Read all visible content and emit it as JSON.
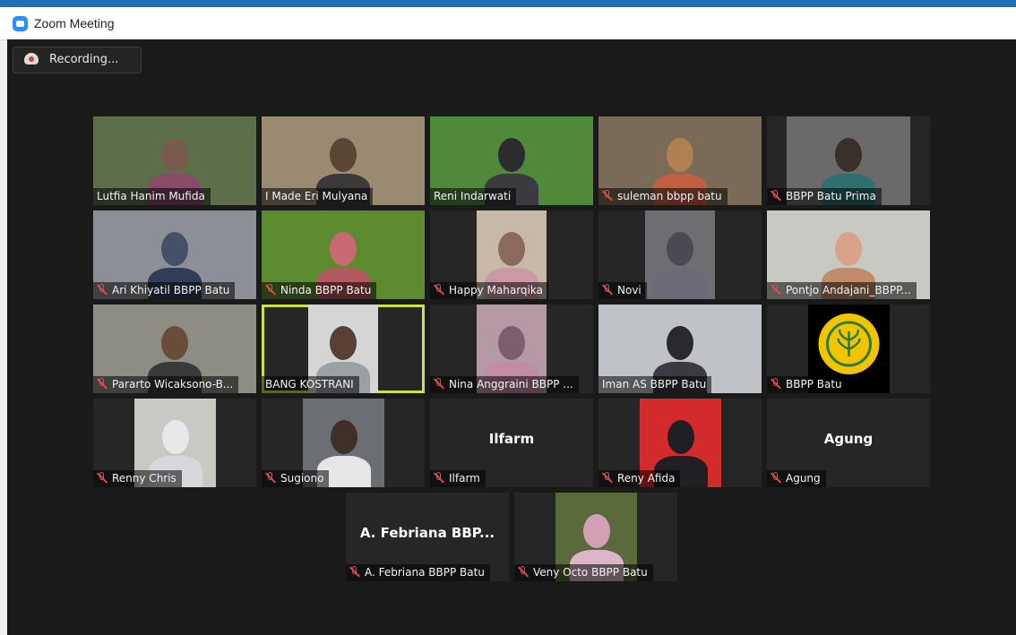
{
  "window": {
    "title": "Zoom Meeting"
  },
  "recording": {
    "label": "Recording...",
    "icon": "cloud-record-icon"
  },
  "rows": [
    [
      {
        "name": "Lutfia Hanim Mufida",
        "muted": false,
        "bg": "#5c6e4a",
        "fill": 1.0,
        "head": "#7b5a4e",
        "body": "#8a4a6a"
      },
      {
        "name": "I Made Eri Mulyana",
        "muted": false,
        "bg": "#9a8a72",
        "fill": 1.0,
        "head": "#5b4636",
        "body": "#3a3a3a"
      },
      {
        "name": "Reni Indarwati",
        "muted": false,
        "bg": "#4f8a3a",
        "fill": 1.0,
        "head": "#2c2c30",
        "body": "#3a3a3f"
      },
      {
        "name": "suleman bbpp batu",
        "muted": true,
        "bg": "#7a6a58",
        "fill": 1.0,
        "head": "#b08050",
        "body": "#c06040"
      },
      {
        "name": "BBPP Batu Prima",
        "muted": true,
        "bg": "#6a6a6a",
        "fill": 0.76,
        "head": "#3b2f2a",
        "body": "#2f6f6f"
      }
    ],
    [
      {
        "name": "Ari Khiyatil BBPP Batu",
        "muted": true,
        "bg": "#8c8f95",
        "fill": 1.0,
        "head": "#44506a",
        "body": "#2f3d56"
      },
      {
        "name": "Ninda BBPP Batu",
        "muted": true,
        "bg": "#5d8a2f",
        "fill": 1.0,
        "head": "#c76a74",
        "body": "#b3585e"
      },
      {
        "name": "Happy Maharqika",
        "muted": true,
        "bg": "#c8b8a8",
        "fill": 0.43,
        "head": "#8a6a5a",
        "body": "#cc9aa6"
      },
      {
        "name": "Novi",
        "muted": true,
        "bg": "#6e6e72",
        "fill": 0.43,
        "head": "#4a4a52",
        "body": "#6a6a78"
      },
      {
        "name": "Pontjo Andajani_BBPP...",
        "muted": true,
        "bg": "#c9c9c3",
        "fill": 1.0,
        "head": "#d9a38a",
        "body": "#c08c6c"
      }
    ],
    [
      {
        "name": "Pararto Wicaksono-B...",
        "muted": true,
        "bg": "#8d8d84",
        "fill": 1.0,
        "head": "#6b4c3a",
        "body": "#3a3a3a"
      },
      {
        "name": "BANG KOSTRANI",
        "muted": false,
        "bg": "#d5d5d5",
        "fill": 0.43,
        "head": "#5a4034",
        "body": "#9aa0a4",
        "active": true
      },
      {
        "name": "Nina Anggraini BBPP ...",
        "muted": true,
        "bg": "#b59aa5",
        "fill": 0.43,
        "head": "#7a5f6f",
        "body": "#c48ba5"
      },
      {
        "name": "Iman AS BBPP Batu",
        "muted": false,
        "bg": "#bfc3c7",
        "fill": 1.0,
        "head": "#2a2a2e",
        "body": "#3a3a40"
      },
      {
        "name": "BBPP Batu",
        "muted": true,
        "bg": "#000000",
        "fill": 0.5,
        "logo": true
      }
    ],
    [
      {
        "name": "Renny Chris",
        "muted": true,
        "bg": "#c9c9c4",
        "fill": 0.5,
        "head": "#e8e8ea",
        "body": "#d8d8dc"
      },
      {
        "name": "Sugiono",
        "muted": true,
        "bg": "#6b6f74",
        "fill": 0.5,
        "head": "#3f2f28",
        "body": "#e6e6e6"
      },
      {
        "name": "Ilfarm",
        "muted": true,
        "bigname": "Ilfarm"
      },
      {
        "name": "Reny Afida",
        "muted": true,
        "bg": "#d32b2b",
        "fill": 0.5,
        "head": "#1f1f24",
        "body": "#1f1f24"
      },
      {
        "name": "Agung",
        "muted": true,
        "bigname": "Agung"
      }
    ],
    [
      {
        "name": "A. Febriana BBPP Batu",
        "muted": true,
        "bigname": "A. Febriana BBP..."
      },
      {
        "name": "Veny Octo BBPP Batu",
        "muted": true,
        "bg": "#5a6a3a",
        "fill": 0.5,
        "head": "#d4a0b8",
        "body": "#dcb6c8"
      }
    ]
  ]
}
